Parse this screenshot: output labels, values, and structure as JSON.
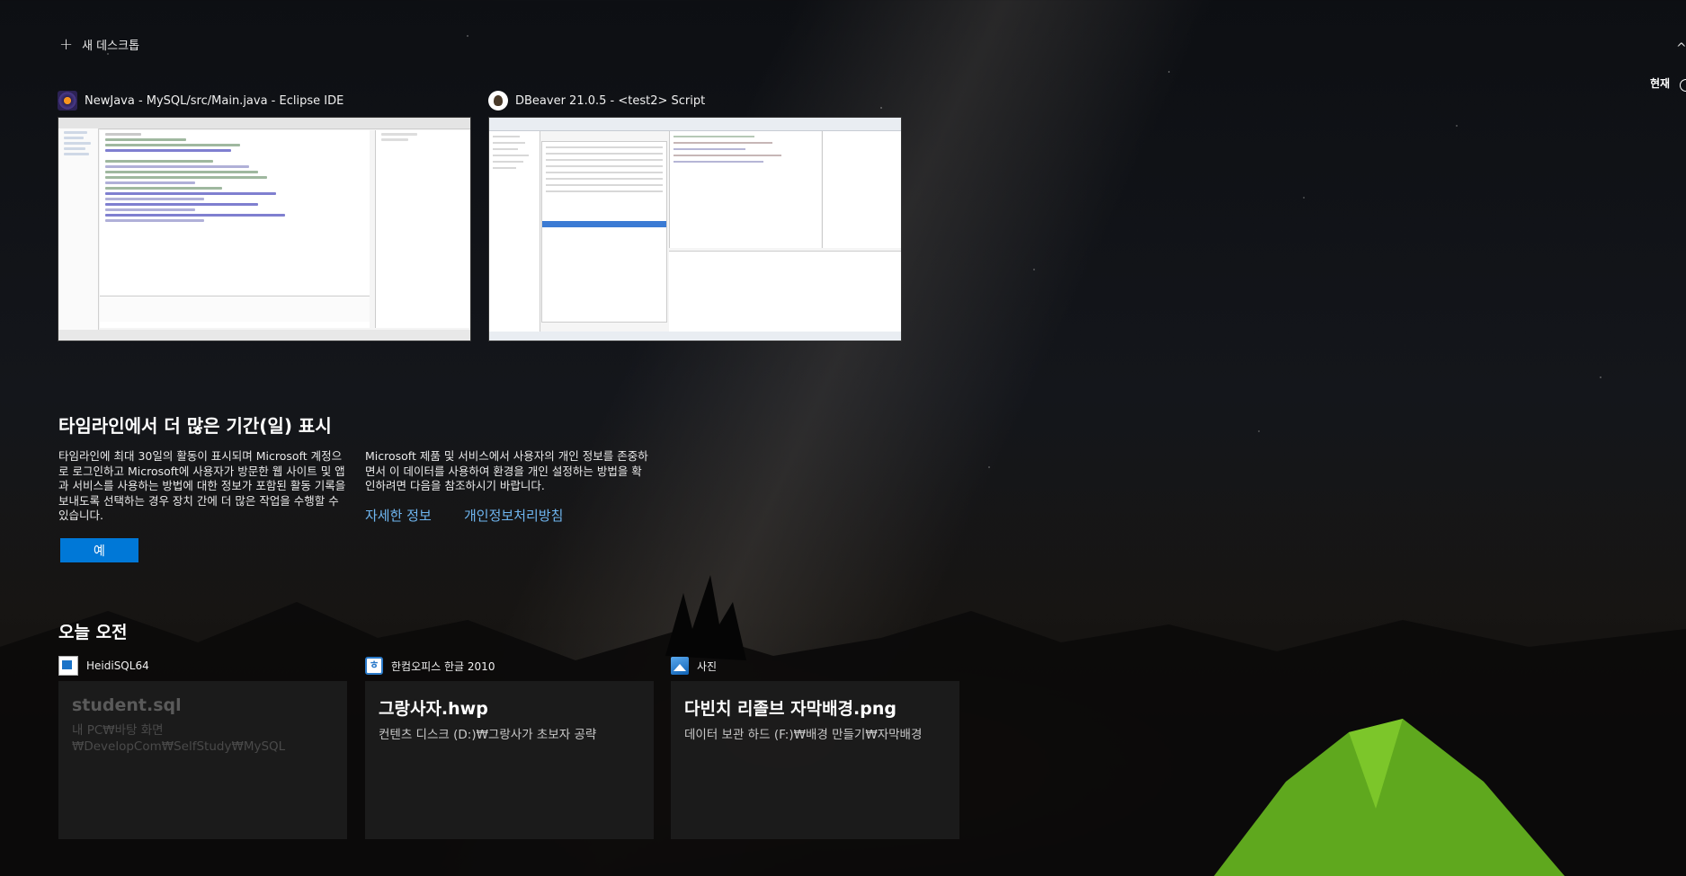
{
  "new_desktop": {
    "label": "새 데스크톱",
    "icon": "plus-icon"
  },
  "timeline_marker": {
    "label": "현재"
  },
  "windows": [
    {
      "title": "NewJava - MySQL/src/Main.java - Eclipse IDE",
      "icon": "eclipse-icon"
    },
    {
      "title": "DBeaver 21.0.5 - <test2> Script",
      "icon": "dbeaver-icon"
    }
  ],
  "promo": {
    "title": "타임라인에서 더 많은 기간(일) 표시",
    "left_text": "타임라인에 최대 30일의 활동이 표시되며 Microsoft 계정으로 로그인하고 Microsoft에 사용자가 방문한 웹 사이트 및 앱과 서비스를 사용하는 방법에 대한 정보가 포함된 활동 기록을 보내도록 선택하는 경우 장치 간에 더 많은 작업을 수행할 수 있습니다.",
    "right_text": "Microsoft 제품 및 서비스에서 사용자의 개인 정보를 존중하면서 이 데이터를 사용하여 환경을 개인 설정하는 방법을 확인하려면 다음을 참조하시기 바랍니다.",
    "link_more": "자세한 정보",
    "link_privacy": "개인정보처리방침",
    "yes_button": "예"
  },
  "section": {
    "title": "오늘 오전"
  },
  "activities": [
    {
      "app": "HeidiSQL64",
      "icon": "heidisql-icon",
      "title": "student.sql",
      "path": "내 PC₩바탕 화면₩DevelopCom₩SelfStudy₩MySQL",
      "dimmed": true
    },
    {
      "app": "한컴오피스 한글 2010",
      "icon": "hwp-icon",
      "title": "그랑사자.hwp",
      "path": "컨텐츠 디스크 (D:)₩그랑사가 초보자 공략",
      "dimmed": false
    },
    {
      "app": "사진",
      "icon": "photos-icon",
      "title": "다빈치 리졸브 자막배경.png",
      "path": "데이터 보관 하드 (F:)₩배경 만들기₩자막배경",
      "dimmed": false
    }
  ]
}
